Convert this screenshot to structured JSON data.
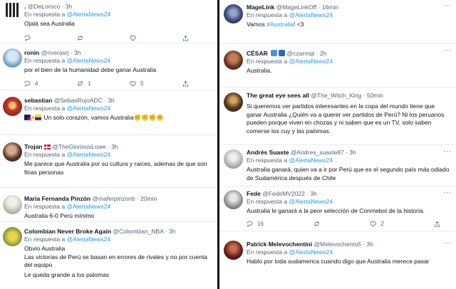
{
  "left": {
    "tweets": [
      {
        "name": ".",
        "handle": "@DeLoroco",
        "time": "3h",
        "reply_prefix": "En respuesta a",
        "mention": "@AlertaNews24",
        "text": "Ojalá sea Australia",
        "counts": {
          "reply": "",
          "retweet": "",
          "like": ""
        }
      },
      {
        "name": "ronin",
        "handle": "@riverasrj",
        "time": "3h",
        "reply_prefix": "En respuesta a",
        "mention": "@AlertaNews24",
        "text": "por el bien de la humanidad debe ganar Australia",
        "counts": {
          "reply": "4",
          "retweet": "1",
          "like": "5"
        }
      },
      {
        "name": "sebastian",
        "handle": "@SebasRojoADC",
        "time": "3h",
        "reply_prefix": "En respuesta a",
        "mention": "@AlertaNews24",
        "text": "Un solo corazón, vamos Australia",
        "counts": {
          "reply": "",
          "retweet": "",
          "like": ""
        }
      },
      {
        "name": "Trojan",
        "handle": "@TheGloriousLowe",
        "time": "3h",
        "reply_prefix": "En respuesta a",
        "mention": "@AlertaNews24",
        "text": "Me parece que Australia por su cultura y raices, ademas de que son finas personas",
        "counts": {
          "reply": "",
          "retweet": "",
          "like": ""
        }
      },
      {
        "name": "María Fernanda Pinzón",
        "handle": "@maferpinzonb",
        "time": "20min",
        "reply_prefix": "En respuesta a",
        "mention": "@AlertaNews24",
        "text": "Australia 6-0 Perú mínimo",
        "counts": {
          "reply": "",
          "retweet": "",
          "like": ""
        }
      },
      {
        "name": "Colombian Never Broke Again",
        "handle": "@Colombian_NBA",
        "time": "3h",
        "reply_prefix": "En respuesta a",
        "mention": "@AlertaNews24",
        "text_lines": [
          "Obvio Australia",
          "Las victorias de Perú se basan en errores de rivales y no por cuenta del equipo",
          "Le queda grande a los palomas"
        ]
      }
    ]
  },
  "right": {
    "tweets": [
      {
        "name": "MageLink",
        "handle": "@MageLinkOff",
        "time": "16min",
        "reply_prefix": "En respuesta a",
        "mention": "@AlertaNews24",
        "text_pre": "Vamos",
        "hashtag": "#Australia",
        "text_post": "! <3",
        "counts": {
          "reply": "",
          "retweet": "",
          "like": ""
        }
      },
      {
        "name": "CÉSAR",
        "handle": "@czarmqt",
        "time": "2h",
        "reply_prefix": "En respuesta a",
        "mention": "@AlertaNews24",
        "text": "Australia.",
        "counts": {
          "reply": "",
          "retweet": "",
          "like": ""
        }
      },
      {
        "name": "The great eye sees all",
        "handle": "@The_Witch_King",
        "time": "50min",
        "text": "Si queremos ver partidos interesantes en la copa del mundo tiene que ganar Australia ¿Quién va a querer ver partidos de Perú? Ni los peruanos pueden porque viven en chozas y ni saben que es un TV, solo saben comerse los cuy y las palomas.",
        "counts": {
          "reply": "",
          "retweet": "",
          "like": ""
        }
      },
      {
        "name": "Andrés Suaste",
        "handle": "@Andres_suaste87",
        "time": "3h",
        "reply_prefix": "En respuesta a",
        "mention": "@AlertaNews24",
        "text": "Australia ganará, quien va a ir por Perú que es el segundo país más odiado de Sudamérica después de Chile",
        "counts": {
          "reply": "",
          "retweet": "",
          "like": ""
        }
      },
      {
        "name": "Fede",
        "handle": "@FedeMV2022",
        "time": "3h",
        "reply_prefix": "En respuesta a",
        "mention": "@AlertaNews24",
        "text": "Australia le ganará a la peor selección de Conmebol de la historia.",
        "counts": {
          "reply": "16",
          "retweet": "",
          "like": "2"
        }
      },
      {
        "name": "Patrick Melevochentini",
        "handle": "@Melevochento5",
        "time": "3h",
        "reply_prefix": "En respuesta a",
        "mention": "@AlertaNews24",
        "text": "Hablo por toda sudamerica cuando digo que Australia merece pasar",
        "counts": {
          "reply": "",
          "retweet": "",
          "like": ""
        }
      }
    ]
  },
  "icons": {
    "reply": "reply-icon",
    "retweet": "retweet-icon",
    "like": "heart-icon",
    "share": "share-icon",
    "more": "more-options-icon"
  },
  "colors": {
    "mention": "#1d9bf0",
    "muted": "#536471",
    "divider": "#111111"
  },
  "more_glyph": "···"
}
